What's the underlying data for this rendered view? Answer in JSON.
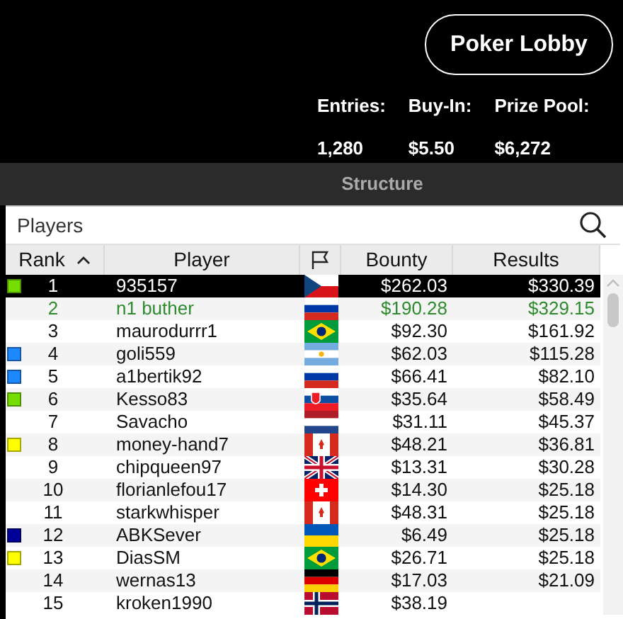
{
  "header": {
    "lobby_button": "Poker Lobby",
    "stats": [
      {
        "label": "Entries:",
        "value": "1,280"
      },
      {
        "label": "Buy-In:",
        "value": "$5.50"
      },
      {
        "label": "Prize Pool:",
        "value": "$6,272"
      }
    ]
  },
  "section_bar": {
    "title": "Structure"
  },
  "search": {
    "placeholder": "Players"
  },
  "table": {
    "columns": [
      {
        "label": "Rank",
        "sorted": true
      },
      {
        "label": "Player",
        "sorted": false
      },
      {
        "kind": "flag"
      },
      {
        "label": "Bounty",
        "sorted": false
      },
      {
        "label": "Results",
        "sorted": false
      }
    ],
    "rows": [
      {
        "color": "#77dd00",
        "rank": "1",
        "player": "935157",
        "flag": {
          "kind": "cz"
        },
        "bounty": "$262.03",
        "results": "$330.39",
        "selected": true,
        "highlighted": false
      },
      {
        "rank": "2",
        "player": "n1 buther",
        "flag": {
          "kind": "ru"
        },
        "bounty": "$190.28",
        "results": "$329.15",
        "selected": false,
        "highlighted": true
      },
      {
        "rank": "3",
        "player": "maurodurrr1",
        "flag": {
          "kind": "br"
        },
        "bounty": "$92.30",
        "results": "$161.92",
        "selected": false,
        "highlighted": false
      },
      {
        "color": "#1e88ff",
        "rank": "4",
        "player": "goli559",
        "flag": {
          "kind": "ar"
        },
        "bounty": "$62.03",
        "results": "$115.28",
        "selected": false,
        "highlighted": false
      },
      {
        "color": "#1e88ff",
        "rank": "5",
        "player": "a1bertik92",
        "flag": {
          "kind": "ru"
        },
        "bounty": "$66.41",
        "results": "$82.10",
        "selected": false,
        "highlighted": false
      },
      {
        "color": "#77dd00",
        "rank": "6",
        "player": "Kesso83",
        "flag": {
          "kind": "sk"
        },
        "bounty": "$35.64",
        "results": "$58.49",
        "selected": false,
        "highlighted": false
      },
      {
        "rank": "7",
        "player": "Savacho",
        "flag": {
          "kind": "nl"
        },
        "bounty": "$31.11",
        "results": "$45.37",
        "selected": false,
        "highlighted": false
      },
      {
        "color": "#ffff00",
        "rank": "8",
        "player": "money-hand7",
        "flag": {
          "kind": "ca"
        },
        "bounty": "$48.21",
        "results": "$36.81",
        "selected": false,
        "highlighted": false
      },
      {
        "rank": "9",
        "player": "chipqueen97",
        "flag": {
          "kind": "gb"
        },
        "bounty": "$13.31",
        "results": "$30.28",
        "selected": false,
        "highlighted": false
      },
      {
        "rank": "10",
        "player": "florianlefou17",
        "flag": {
          "kind": "ch"
        },
        "bounty": "$14.30",
        "results": "$25.18",
        "selected": false,
        "highlighted": false
      },
      {
        "rank": "11",
        "player": "starkwhisper",
        "flag": {
          "kind": "ca"
        },
        "bounty": "$48.31",
        "results": "$25.18",
        "selected": false,
        "highlighted": false
      },
      {
        "color": "#000099",
        "rank": "12",
        "player": "ABKSever",
        "flag": {
          "kind": "ua"
        },
        "bounty": "$6.49",
        "results": "$25.18",
        "selected": false,
        "highlighted": false
      },
      {
        "color": "#ffff00",
        "rank": "13",
        "player": "DiasSM",
        "flag": {
          "kind": "br"
        },
        "bounty": "$26.71",
        "results": "$25.18",
        "selected": false,
        "highlighted": false
      },
      {
        "rank": "14",
        "player": "wernas13",
        "flag": {
          "kind": "de"
        },
        "bounty": "$17.03",
        "results": "$21.09",
        "selected": false,
        "highlighted": false
      },
      {
        "rank": "15",
        "player": "kroken1990",
        "flag": {
          "kind": "no"
        },
        "bounty": "$38.19",
        "selected": false,
        "highlighted": false
      }
    ]
  }
}
